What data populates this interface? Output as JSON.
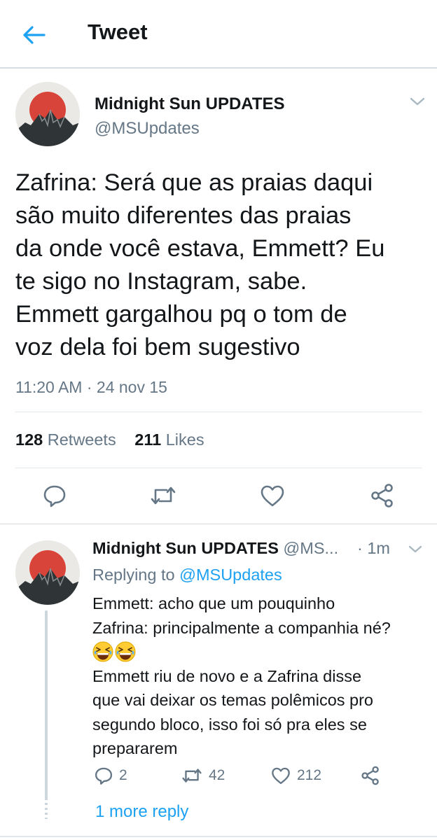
{
  "header": {
    "title": "Tweet",
    "back_icon": "arrow-left-icon",
    "accent": "#1da1f2"
  },
  "tweet": {
    "author_name": "Midnight Sun UPDATES",
    "author_handle": "@MSUpdates",
    "text_lines": [
      "Zafrina: Será que as praias daqui",
      "são muito diferentes das praias",
      "da onde você estava, Emmett? Eu",
      "te sigo no Instagram, sabe.",
      "Emmett gargalhou pq o tom de",
      "voz dela foi bem sugestivo"
    ],
    "timestamp": "11:20 AM · 24 nov 15",
    "retweets_count": "128",
    "retweets_label": "Retweets",
    "likes_count": "211",
    "likes_label": "Likes",
    "actions": [
      "reply-icon",
      "retweet-icon",
      "like-icon",
      "share-icon"
    ]
  },
  "reply": {
    "author_name": "Midnight Sun UPDATES",
    "author_handle": "@MS...",
    "time": "· 1m",
    "replying_prefix": "Replying to",
    "replying_to": "@MSUpdates",
    "lines_before_emoji": [
      "Emmett: acho que um pouquinho",
      "Zafrina: principalmente a companhia né?"
    ],
    "emoji": [
      "grinning-squinting-face-emoji",
      "grinning-squinting-face-emoji"
    ],
    "lines_after_emoji": [
      "Emmett riu de novo e a Zafrina disse",
      "que vai deixar os temas polêmicos pro",
      "segundo bloco, isso foi só pra eles se",
      "prepararem"
    ],
    "reply_count": "2",
    "retweet_count": "42",
    "like_count": "212"
  },
  "thread": {
    "more_replies": "1 more reply"
  },
  "colors": {
    "text": "#14171a",
    "secondary": "#657786",
    "link": "#1da1f2",
    "divider": "#e1e8ed"
  }
}
